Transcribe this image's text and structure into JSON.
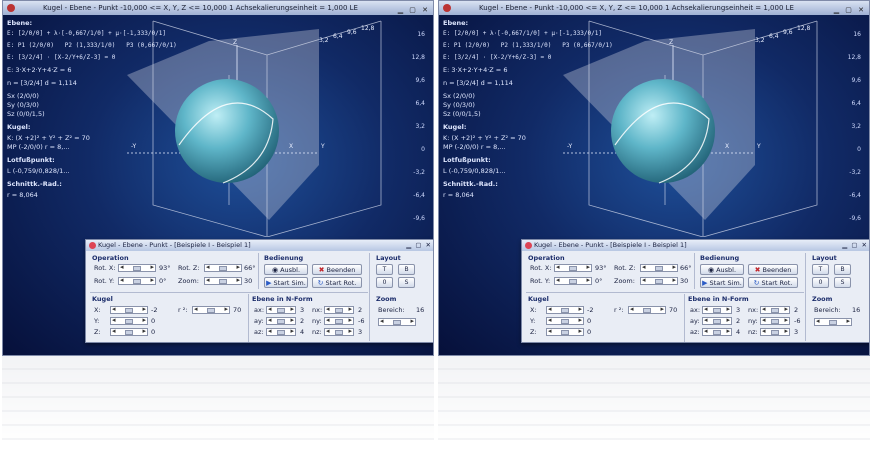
{
  "app": {
    "title": "Kugel - Ebene - Punkt   -10,000 <= X, Y, Z <= 10,000    1 Achsekalierungseinheit = 1,000 LE"
  },
  "info": {
    "ebene_heading": "Ebene:",
    "ebene_param": "E: [2/0/0] + λ·[-0,667/1/0] + μ·[-1,333/0/1]",
    "ebene_points": "E: P1 (2/0/0)   P2 (1,333/1/0)   P3 (0,667/0/1)",
    "ebene_matrix": "E: [3/2/4] · [X-2/Y+6/Z-3] = 0",
    "ebene_coord": "E: 3·X+2·Y+4·Z = 6",
    "normal": "n = [3/2/4]      d = 1,114",
    "sx": "Sx (2/0/0)",
    "sy": "Sy (0/3/0)",
    "sz": "Sz (0/0/1,5)",
    "kugel_heading": "Kugel:",
    "kugel_eq": "K: (X +2)² + Y² + Z² = 70",
    "kugel_mp": "MP (-2/0/0)   r = 8,...",
    "lotfuss_heading": "Lotfußpunkt:",
    "lotfuss_val": "L (-0,759/0,828/1...",
    "schnitt_heading": "Schnittk.-Rad.:",
    "schnitt_val": "r = 8,064"
  },
  "scene": {
    "axis_y_neg": "-Y",
    "axis_y_pos": "Y",
    "axis_x": "X",
    "axis_z": "Z",
    "ruler_values": [
      "-10",
      "-8",
      "-6",
      "-4",
      "-2",
      "0",
      "2",
      "4",
      "6",
      "8",
      "10"
    ],
    "scale_top": [
      "3,2",
      "6,4",
      "9,6",
      "12,8"
    ],
    "scale_right": [
      "16",
      "12,8",
      "9,6",
      "6,4",
      "3,2",
      "0",
      "-3,2",
      "-6,4",
      "-9,6"
    ]
  },
  "dialog": {
    "title": "Kugel - Ebene - Punkt - [Beispiele I - Beispiel 1]",
    "operation": {
      "heading": "Operation",
      "rotx_label": "Rot. X:",
      "rotx_value": "93°",
      "roty_label": "Rot. Y:",
      "roty_value": "0°",
      "rotz_label": "Rot. Z:",
      "rotz_value": "66°",
      "zoom_label": "Zoom:",
      "zoom_value": "30"
    },
    "bedienung": {
      "heading": "Bedienung",
      "ausbl": "Ausbl.",
      "beenden": "Beenden",
      "start_sim": "Start Sim.",
      "start_rot": "Start Rot."
    },
    "layout": {
      "heading": "Layout",
      "buttons": [
        "T",
        "B",
        "0",
        "S"
      ]
    },
    "kugel": {
      "heading": "Kugel",
      "x_label": "X:",
      "x_value": "-2",
      "y_label": "Y:",
      "y_value": "0",
      "z_label": "Z:",
      "z_value": "0",
      "r2_label": "r ²:",
      "r2_value": "70"
    },
    "ebene": {
      "heading": "Ebene in N-Form",
      "rows": [
        {
          "a": "ax:",
          "av": "3",
          "n": "nx:",
          "nv": "2"
        },
        {
          "a": "ay:",
          "av": "2",
          "n": "ny:",
          "nv": "-6"
        },
        {
          "a": "az:",
          "av": "4",
          "n": "nz:",
          "nv": "3"
        }
      ]
    },
    "zoom": {
      "heading": "Zoom",
      "bereich_label": "Bereich:",
      "bereich_value": "16"
    }
  },
  "colors": {
    "background_deep": "#06103a",
    "background_mid": "#1e4f99",
    "sphere": "#5fb6c9",
    "plane": "#d6dbe6",
    "accent_red": "#c0262c"
  }
}
